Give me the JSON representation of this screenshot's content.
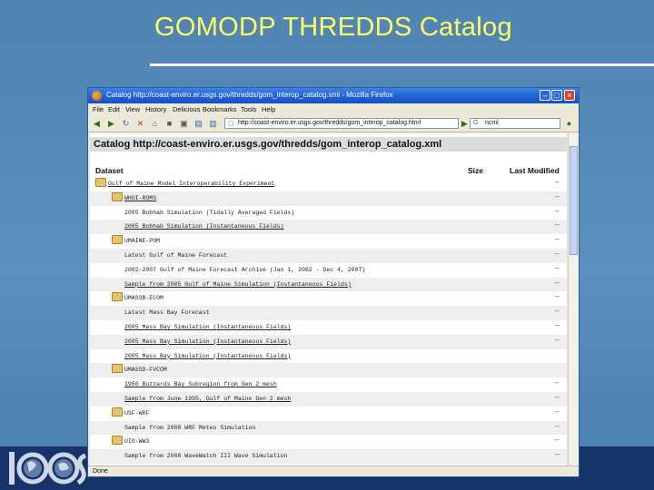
{
  "slide": {
    "title": "GOMODP THREDDS Catalog"
  },
  "browser": {
    "window_title": "Catalog http://coast-enviro.er.usgs.gov/thredds/gom_interop_catalog.xml - Mozilla Firefox",
    "menu": [
      "File",
      "Edit",
      "View",
      "History",
      "Delicious",
      "Bookmarks",
      "Tools",
      "Help"
    ],
    "url": "http://coast-enviro.er.usgs.gov/thredds/gom_interop_catalog.html",
    "search_value": "ncml",
    "status": "Done"
  },
  "page": {
    "heading": "Catalog http://coast-enviro.er.usgs.gov/thredds/gom_interop_catalog.xml",
    "columns": {
      "dataset": "Dataset",
      "size": "Size",
      "modified": "Last Modified"
    },
    "rows": [
      {
        "label": "Gulf of Maine Model Interoperability Experiment",
        "folder": true,
        "indent": 0,
        "link": true,
        "modified": "--"
      },
      {
        "label": "WHOI-ROMS",
        "folder": true,
        "indent": 1,
        "link": true,
        "modified": "--"
      },
      {
        "label": "2005 Bobhab Simulation (Tidally Averaged Fields)",
        "folder": false,
        "indent": 2,
        "link": false,
        "modified": "--"
      },
      {
        "label": "2005 Bobhab Simulation (Instantaneous Fields)",
        "folder": false,
        "indent": 2,
        "link": true,
        "modified": "--"
      },
      {
        "label": "UMAINE-POM",
        "folder": true,
        "indent": 1,
        "link": false,
        "modified": "--"
      },
      {
        "label": "Latest Gulf of Maine Forecast",
        "folder": false,
        "indent": 2,
        "link": false,
        "modified": "--"
      },
      {
        "label": "2002-2007 Gulf of Maine Forecast Archive (Jan 1, 2002 - Dec 4, 2007)",
        "folder": false,
        "indent": 2,
        "link": false,
        "modified": "--"
      },
      {
        "label": "Sample from 2005 Gulf of Maine Simulation (Instantaneous Fields)",
        "folder": false,
        "indent": 2,
        "link": true,
        "modified": "--"
      },
      {
        "label": "UMASSB-ECOM",
        "folder": true,
        "indent": 1,
        "link": false,
        "modified": "--"
      },
      {
        "label": "Latest Mass Bay Forecast",
        "folder": false,
        "indent": 2,
        "link": false,
        "modified": "--"
      },
      {
        "label": "2005 Mass Bay Simulation (Instantaneous Fields)",
        "folder": false,
        "indent": 2,
        "link": true,
        "modified": "--"
      },
      {
        "label": "2005 Mass Bay Simulation (Instantaneous Fields)",
        "folder": false,
        "indent": 2,
        "link": true,
        "modified": "--"
      },
      {
        "label": "2005 Mass Bay Simulation (Instantaneous Fields)",
        "folder": false,
        "indent": 2,
        "link": true,
        "modified": ""
      },
      {
        "label": "UMASSD-FVCOM",
        "folder": true,
        "indent": 1,
        "link": false,
        "modified": ""
      },
      {
        "label": "1950 Buzzards Bay Subregion from Gen 2 mesh",
        "folder": false,
        "indent": 2,
        "link": true,
        "modified": "--"
      },
      {
        "label": "Sample from June 1995, Gulf of Maine Gen 2 mesh",
        "folder": false,
        "indent": 2,
        "link": true,
        "modified": "--"
      },
      {
        "label": "USF-WRF",
        "folder": true,
        "indent": 1,
        "link": false,
        "modified": "--"
      },
      {
        "label": "Sample from 2008 WRF Meteo Simulation",
        "folder": false,
        "indent": 2,
        "link": false,
        "modified": "--"
      },
      {
        "label": "UIO-WW3",
        "folder": true,
        "indent": 1,
        "link": false,
        "modified": "--"
      },
      {
        "label": "Sample from 2008 WaveWatch III Wave Simulation",
        "folder": false,
        "indent": 2,
        "link": false,
        "modified": "--"
      }
    ]
  }
}
